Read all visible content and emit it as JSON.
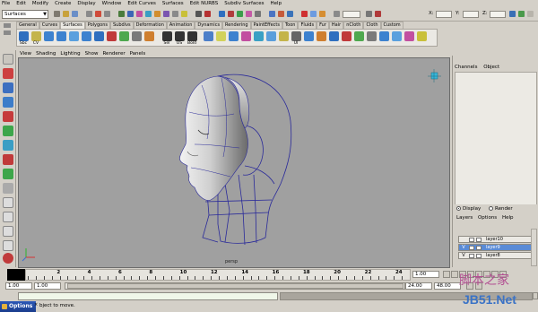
{
  "menubar": {
    "items": [
      "File",
      "Edit",
      "Modify",
      "Create",
      "Display",
      "Window",
      "Edit Curves",
      "Surfaces",
      "Edit NURBS",
      "Subdiv Surfaces",
      "Help"
    ]
  },
  "statusline": {
    "mode": "Surfaces",
    "x_label": "X:",
    "y_label": "Y:",
    "z_label": "Z:"
  },
  "shelf": {
    "tabs": [
      "General",
      "Curves",
      "Surfaces",
      "Polygons",
      "Subdivs",
      "Deformation",
      "Animation",
      "Dynamics",
      "Rendering",
      "PaintEffects",
      "Toon",
      "Fluids",
      "Fur",
      "Hair",
      "nCloth",
      "Cloth",
      "Custom"
    ],
    "active_tab": "Surfaces",
    "icon_labels": [
      "Sbc",
      "CV",
      "",
      "",
      "",
      "",
      "",
      "",
      "",
      "",
      "",
      "Sel",
      "OS",
      "Bold",
      "",
      "",
      "",
      "",
      "",
      "",
      "",
      "UI",
      "",
      "",
      "",
      "",
      "",
      "",
      "",
      "",
      "",
      "",
      ""
    ]
  },
  "viewport": {
    "menu": [
      "View",
      "Shading",
      "Lighting",
      "Show",
      "Renderer",
      "Panels"
    ],
    "camera_label": "persp",
    "axis_labels": {
      "x": "x",
      "y": "y",
      "z": "z"
    }
  },
  "channelbox": {
    "menu": [
      "Channels",
      "Object"
    ]
  },
  "layers": {
    "radio_display": "Display",
    "radio_render": "Render",
    "menu": [
      "Layers",
      "Options",
      "Help"
    ],
    "rows": [
      {
        "v": "",
        "name": "layer10",
        "selected": false
      },
      {
        "v": "V",
        "name": "layer9",
        "selected": true
      },
      {
        "v": "V",
        "name": "layer8",
        "selected": false
      }
    ]
  },
  "timeslider": {
    "ticks": [
      "2",
      "4",
      "6",
      "8",
      "10",
      "12",
      "14",
      "16",
      "18",
      "20",
      "22",
      "24"
    ],
    "current": "1.00"
  },
  "rangeslider": {
    "start": "1.00",
    "inner_start": "1.00",
    "inner_end": "24.00",
    "end": "48.00"
  },
  "helpline": {
    "options_label": "Options",
    "text": "bject to move."
  },
  "watermark": {
    "line1": "脚本之家",
    "line2": "JB51.Net"
  },
  "colors": {
    "accent": "#2b57b7",
    "viewport_bg": "#a0a0a0",
    "wire": "#2a2a9a",
    "layer_selected": "#5a8bd6"
  }
}
